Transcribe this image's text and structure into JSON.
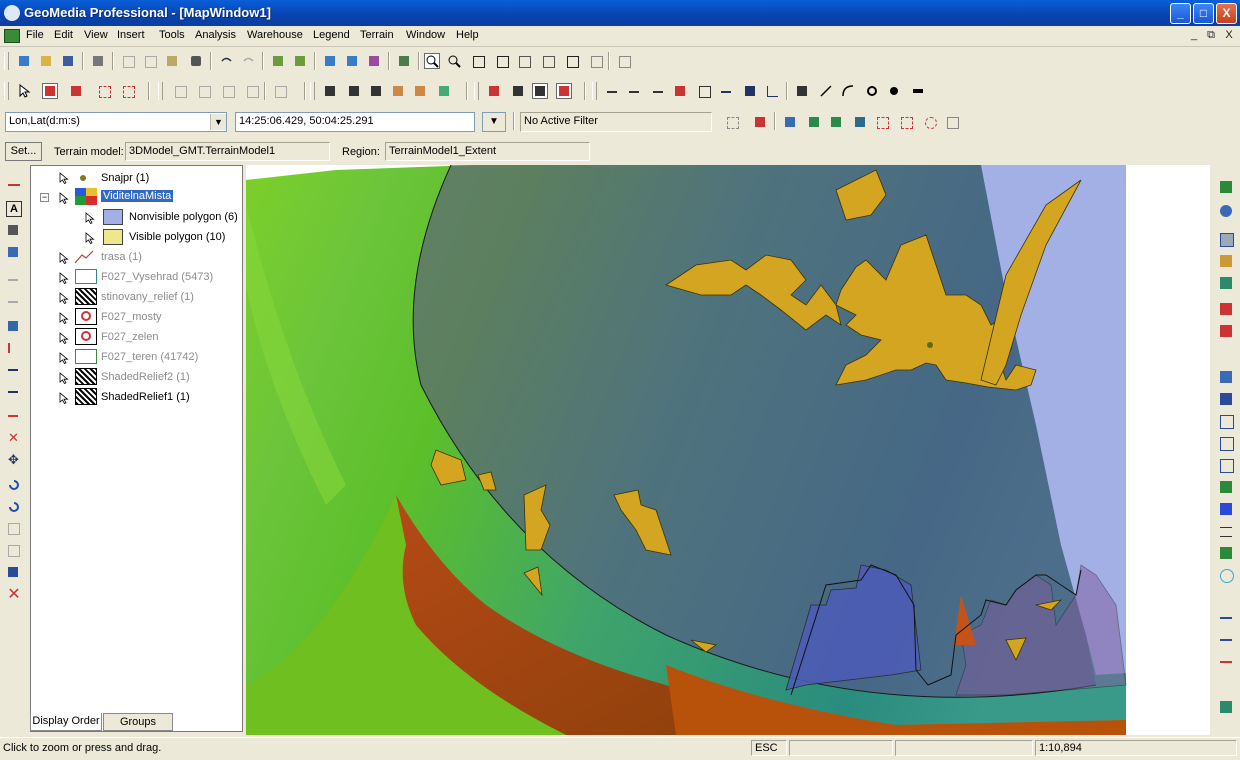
{
  "window": {
    "title": "GeoMedia Professional - [MapWindow1]",
    "controls": [
      "_",
      "□",
      "X"
    ]
  },
  "menu": {
    "items": [
      "File",
      "Edit",
      "View",
      "Insert",
      "Tools",
      "Analysis",
      "Warehouse",
      "Legend",
      "Terrain",
      "Window",
      "Help"
    ],
    "mdi_controls": [
      "_",
      "⧉",
      "X"
    ]
  },
  "coordinate_bar": {
    "coordinate_system": "Lon,Lat(d:m:s)",
    "coordinate_value": "14:25:06.429, 50:04:25.291",
    "filter": "No Active Filter"
  },
  "terrain_bar": {
    "set_button": "Set...",
    "terrain_model_label": "Terrain model:",
    "terrain_model_value": "3DModel_GMT.TerrainModel1",
    "region_label": "Region:",
    "region_value": "TerrainModel1_Extent"
  },
  "legend": {
    "entries": [
      {
        "label": "Snajpr (1)",
        "icon": "point-symbol-icon",
        "visible": true,
        "indent": 0
      },
      {
        "label": "ViditelnaMista",
        "icon": "group-legend-icon",
        "visible": true,
        "indent": 0,
        "selected": true,
        "expander": "−"
      },
      {
        "label": "Nonvisible polygon (6)",
        "icon": "blue-polygon-swatch",
        "visible": true,
        "indent": 1,
        "color": "#a3b0e6"
      },
      {
        "label": "Visible polygon (10)",
        "icon": "yellow-polygon-swatch",
        "visible": true,
        "indent": 1,
        "color": "#f0e68c"
      },
      {
        "label": "trasa (1)",
        "icon": "line-symbol-icon",
        "visible": false,
        "indent": 0
      },
      {
        "label": "F027_Vysehrad (5473)",
        "icon": "area-symbol-icon",
        "visible": false,
        "indent": 0
      },
      {
        "label": "stinovany_relief (1)",
        "icon": "raster-symbol-icon",
        "visible": false,
        "indent": 0
      },
      {
        "label": "F027_mosty",
        "icon": "no-data-symbol-icon",
        "visible": false,
        "indent": 0
      },
      {
        "label": "F027_zelen",
        "icon": "no-data-symbol-icon",
        "visible": false,
        "indent": 0
      },
      {
        "label": "F027_teren (41742)",
        "icon": "area-symbol-icon",
        "visible": false,
        "indent": 0
      },
      {
        "label": "ShadedRelief2 (1)",
        "icon": "raster-symbol-icon",
        "visible": false,
        "indent": 0
      },
      {
        "label": "ShadedRelief1 (1)",
        "icon": "raster-symbol-icon",
        "visible": true,
        "indent": 0
      }
    ],
    "tabs": [
      "Display Order",
      "Groups"
    ]
  },
  "status": {
    "message": "Click to zoom or press and drag.",
    "key": "ESC",
    "scale": "1:10,894"
  },
  "colors": {
    "titlebar": "#0a5fd8",
    "chrome": "#ece9d8",
    "visible_polygon": "#d4a520",
    "nonvisible_polygon": "#a3b0e6"
  }
}
